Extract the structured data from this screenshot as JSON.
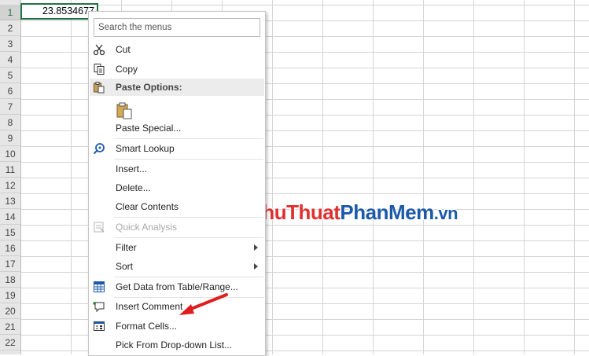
{
  "sheet": {
    "row_numbers": [
      "1",
      "2",
      "3",
      "4",
      "5",
      "6",
      "7",
      "8",
      "9",
      "10",
      "11",
      "12",
      "13",
      "14",
      "15",
      "16",
      "17",
      "18",
      "19",
      "20",
      "21",
      "22"
    ],
    "cell_a1_value": "23.8534677"
  },
  "context_menu": {
    "search_placeholder": "Search the menus",
    "cut": "Cut",
    "copy": "Copy",
    "paste_options": "Paste Options:",
    "paste_special": "Paste Special...",
    "smart_lookup": "Smart Lookup",
    "insert": "Insert...",
    "delete": "Delete...",
    "clear_contents": "Clear Contents",
    "quick_analysis": "Quick Analysis",
    "filter": "Filter",
    "sort": "Sort",
    "get_data": "Get Data from Table/Range...",
    "insert_comment": "Insert Comment",
    "format_cells": "Format Cells...",
    "pick_dropdown": "Pick From Drop-down List..."
  },
  "watermark": {
    "part1": "ThuThuat",
    "part2": "PhanMem",
    "part3": ".vn"
  },
  "colors": {
    "excel_green": "#217346",
    "highlight_red": "#e01e1e",
    "icon_blue": "#1c5aa8"
  }
}
